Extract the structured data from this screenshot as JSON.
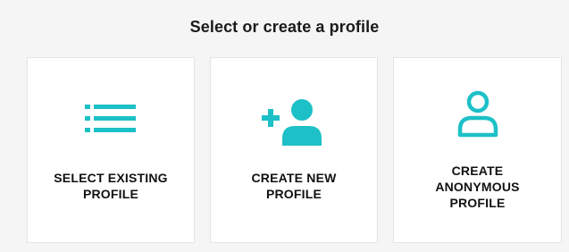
{
  "title": "Select or create a profile",
  "accent_color": "#1cc0c6",
  "cards": [
    {
      "label_lines": [
        "SELECT EXISTING",
        "PROFILE"
      ],
      "icon": "list-icon"
    },
    {
      "label_lines": [
        "CREATE NEW",
        "PROFILE"
      ],
      "icon": "add-user-icon"
    },
    {
      "label_lines": [
        "CREATE",
        "ANONYMOUS",
        "PROFILE"
      ],
      "icon": "user-outline-icon"
    }
  ]
}
